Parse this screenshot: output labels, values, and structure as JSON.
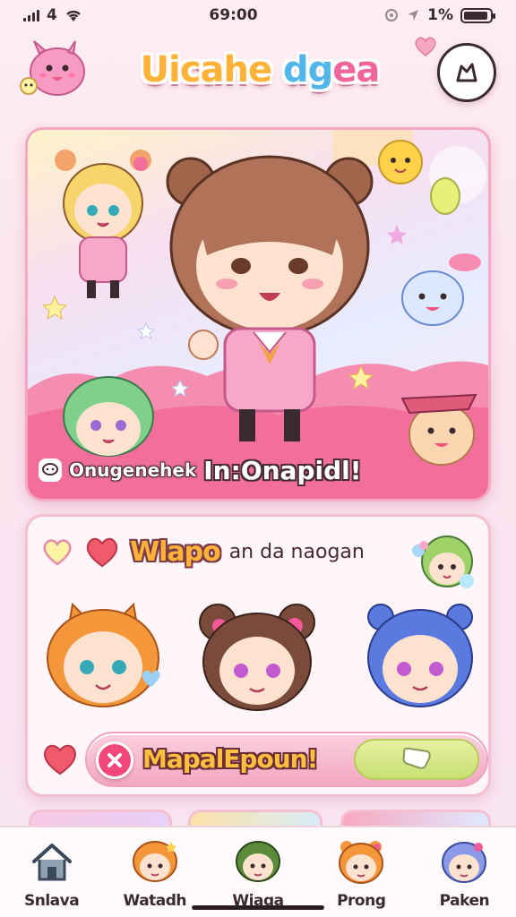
{
  "status_bar": {
    "carrier": "4",
    "time": "69:00",
    "battery_text": "1%",
    "battery_level": 0.92
  },
  "header": {
    "title_part1": "Uicahe",
    "title_part2": "dg",
    "title_part3": "ea"
  },
  "hero": {
    "caption_small": "Onugenehek",
    "caption_big": "In:Onapidl!"
  },
  "match": {
    "title": "Wlapo",
    "subtitle": "an da naogan",
    "button_label": "MapalEpoun!"
  },
  "tabs": [
    {
      "label": "Snlava",
      "icon": "home-icon"
    },
    {
      "label": "Watadh",
      "icon": "orange-hair-avatar-icon"
    },
    {
      "label": "Wiaga",
      "icon": "green-hair-avatar-icon"
    },
    {
      "label": "Prong",
      "icon": "orange-bun-avatar-icon"
    },
    {
      "label": "Paken",
      "icon": "blue-hair-avatar-icon"
    }
  ],
  "colors": {
    "accent_pink": "#f0669a",
    "accent_yellow": "#ffb238",
    "accent_blue": "#52b7e8",
    "go_green": "#c9df74"
  }
}
